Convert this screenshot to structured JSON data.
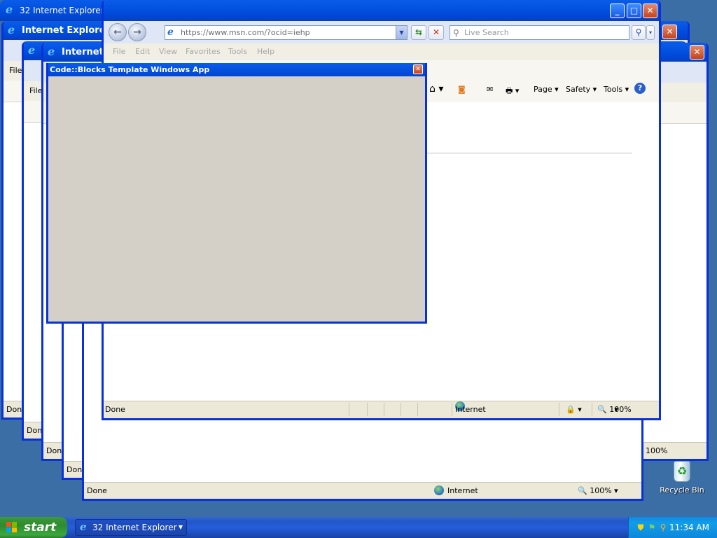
{
  "taskbar": {
    "start_label": "start",
    "task_button_label": "32 Internet Explorer",
    "clock": "11:34 AM"
  },
  "desktop": {
    "recycle_bin_label": "Recycle Bin"
  },
  "group_title": "32 Internet Explorer",
  "background_windows": {
    "title": "Internet Explorer",
    "menu_file": "File",
    "status_done": "Done",
    "status_internet": "Internet",
    "zoom": "100%"
  },
  "front_window": {
    "address": "https://www.msn.com/?ocid=iehp",
    "search_placeholder": "Live Search",
    "menu": [
      "File",
      "Edit",
      "View",
      "Favorites",
      "Tools",
      "Help"
    ],
    "command_bar": {
      "page": "Page",
      "safety": "Safety",
      "tools": "Tools"
    },
    "status": {
      "text": "Done",
      "zone": "Internet",
      "zoom": "100%"
    }
  },
  "codeblocks_window": {
    "title": "Code::Blocks Template Windows App"
  }
}
